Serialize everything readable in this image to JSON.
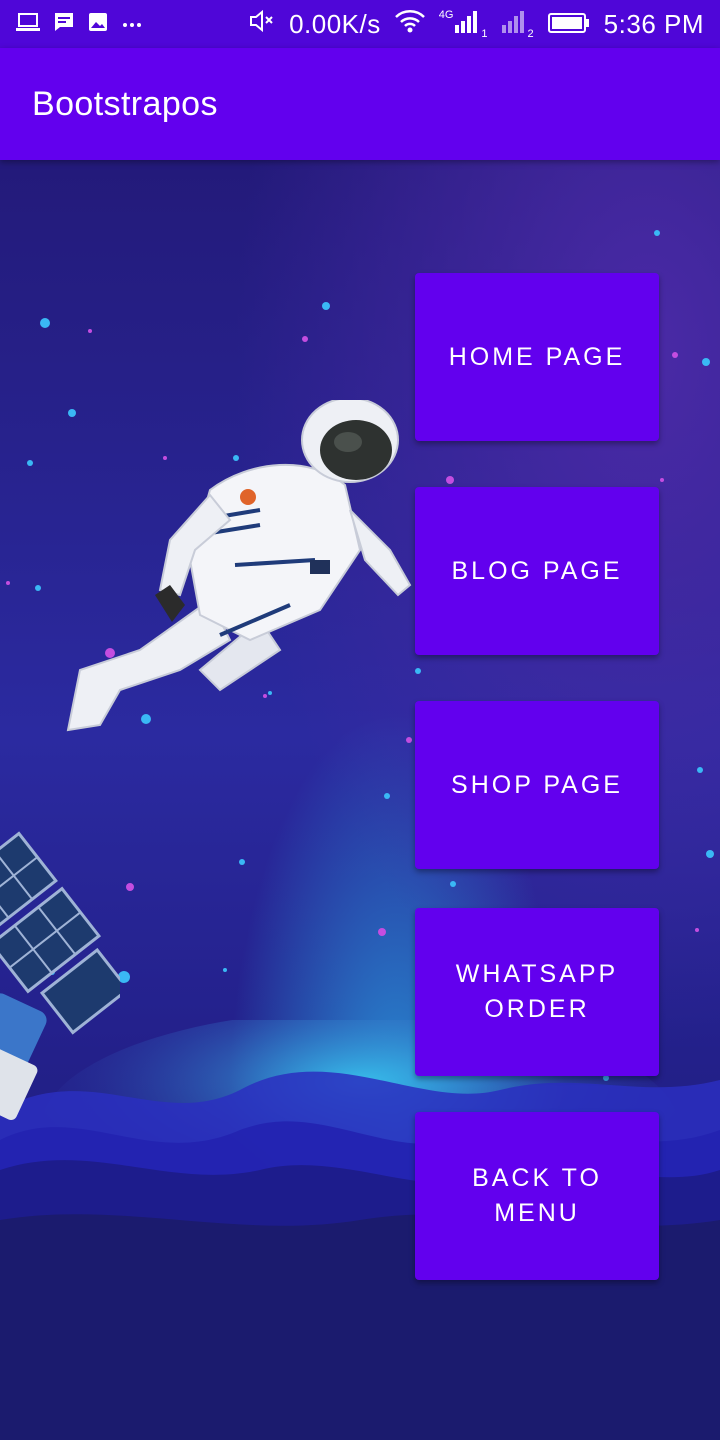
{
  "status_bar": {
    "left_icons": [
      "laptop-icon",
      "message-icon",
      "image-icon",
      "more-dots-icon"
    ],
    "net_speed": "0.00K/s",
    "network_label": "4G",
    "sim1": "1",
    "sim2": "2",
    "time": "5:36 PM",
    "right_icons": [
      "mute-icon",
      "wifi-icon",
      "signal-sim1-icon",
      "signal-sim2-icon",
      "battery-icon"
    ]
  },
  "app_bar": {
    "title": "Bootstrapos"
  },
  "menu": {
    "buttons": [
      {
        "label": "HOME  PAGE"
      },
      {
        "label": "BLOG  PAGE"
      },
      {
        "label": "SHOP  PAGE"
      },
      {
        "label": "WHATSAPP ORDER"
      },
      {
        "label": "BACK  TO MENU"
      }
    ]
  },
  "background": {
    "illustration": [
      "astronaut-illustration",
      "satellite-illustration",
      "wave-illustration",
      "stars"
    ],
    "colors": {
      "primary": "#6200ee",
      "status_bar": "#4f06d8",
      "space_dark": "#1b1b6e",
      "accent_blue": "#2fb3f0"
    }
  }
}
